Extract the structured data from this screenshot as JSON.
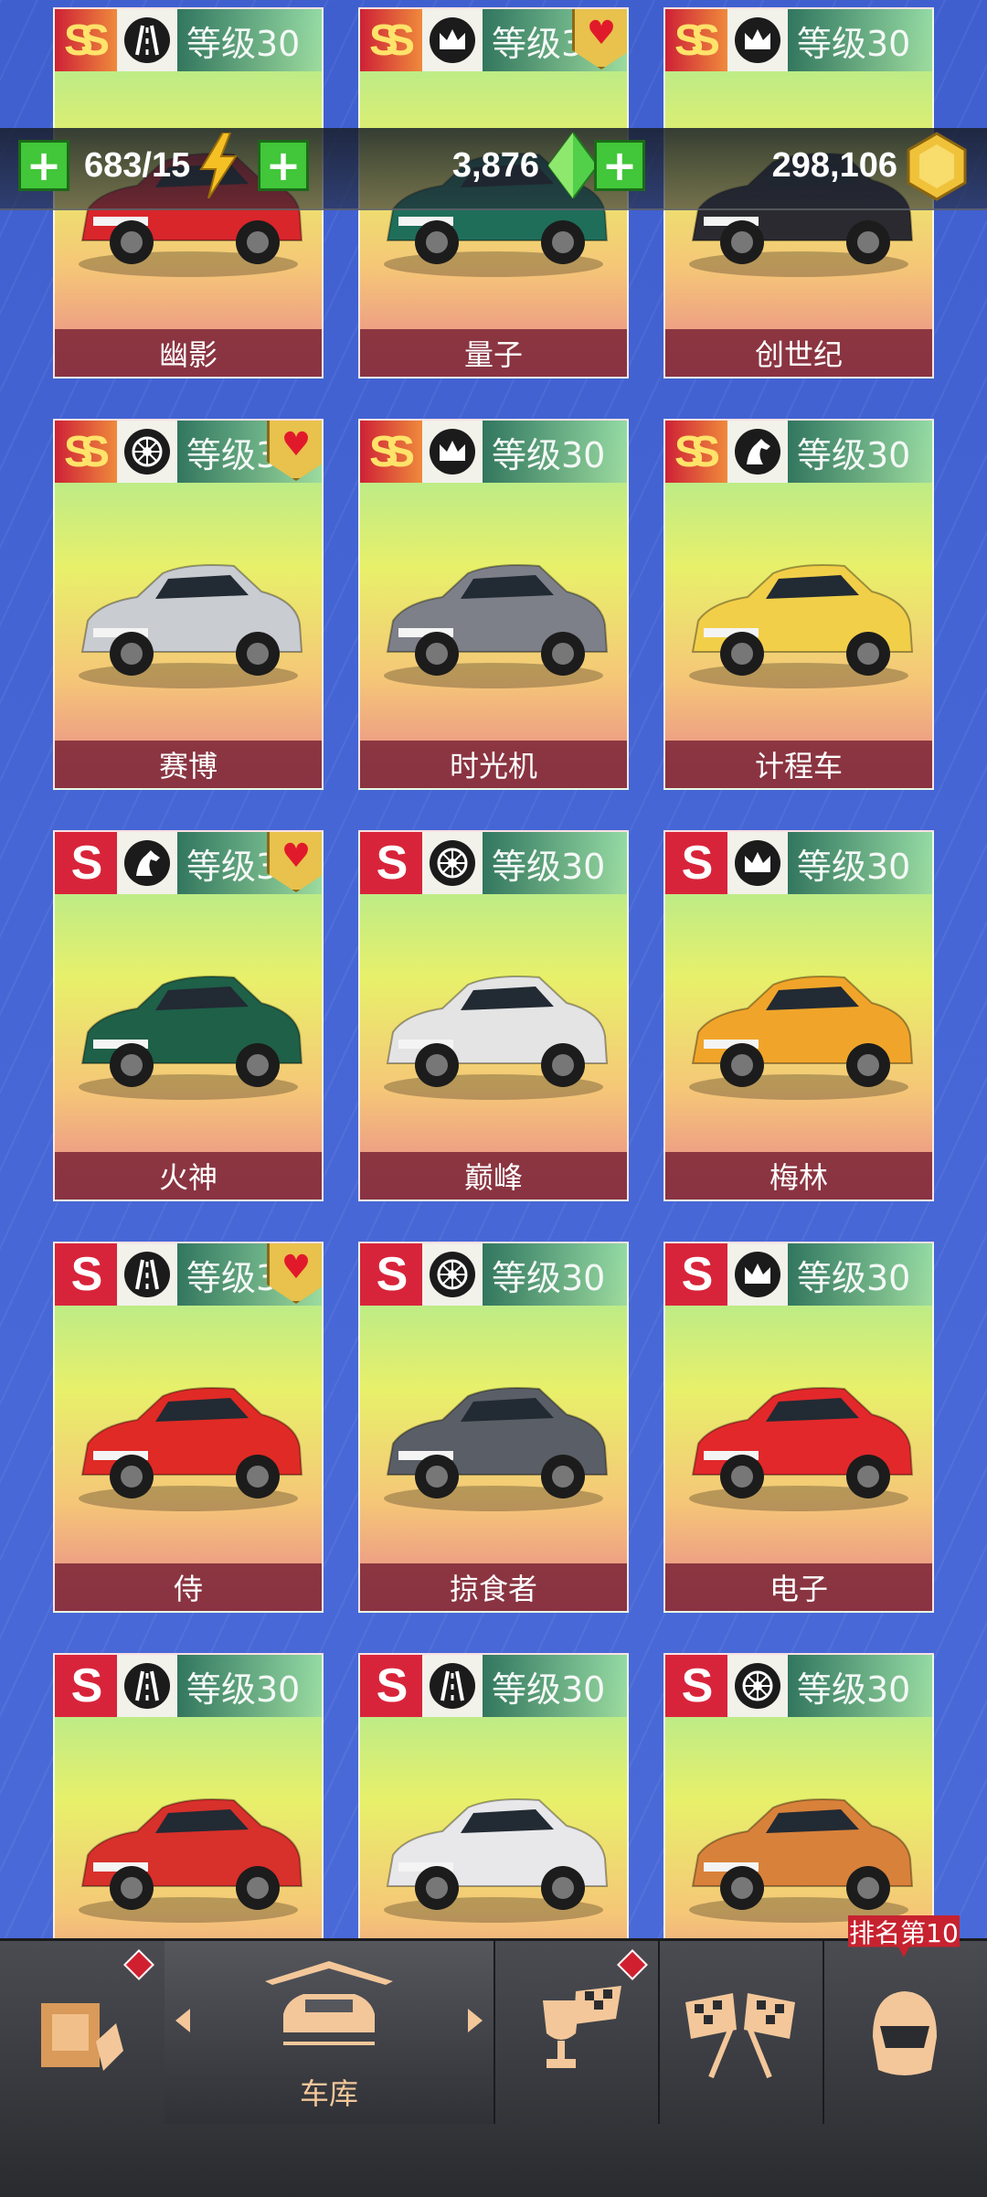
{
  "currency": {
    "energy": "683/15",
    "gems": "3,876",
    "coins": "298,106"
  },
  "cars": [
    {
      "rank": "SS",
      "tag": "road-icon",
      "level": "等级30",
      "fav": false,
      "name": "幽影",
      "color": "#d8262b"
    },
    {
      "rank": "SS",
      "tag": "crown-icon",
      "level": "等级3",
      "fav": true,
      "name": "量子",
      "color": "#1f6e5a"
    },
    {
      "rank": "SS",
      "tag": "crown-icon",
      "level": "等级30",
      "fav": false,
      "name": "创世纪",
      "color": "#2a2a30"
    },
    {
      "rank": "SS",
      "tag": "wheel-icon",
      "level": "等级3",
      "fav": true,
      "name": "赛博",
      "color": "#c9ccd0"
    },
    {
      "rank": "SS",
      "tag": "crown-icon",
      "level": "等级30",
      "fav": false,
      "name": "时光机",
      "color": "#7d8088"
    },
    {
      "rank": "SS",
      "tag": "horse-icon",
      "level": "等级30",
      "fav": false,
      "name": "计程车",
      "color": "#f2cf49"
    },
    {
      "rank": "S",
      "tag": "horse-icon",
      "level": "等级3",
      "fav": true,
      "name": "火神",
      "color": "#1e6048"
    },
    {
      "rank": "S",
      "tag": "wheel-icon",
      "level": "等级30",
      "fav": false,
      "name": "巅峰",
      "color": "#e4e4e4"
    },
    {
      "rank": "S",
      "tag": "crown-icon",
      "level": "等级30",
      "fav": false,
      "name": "梅林",
      "color": "#f0a52a"
    },
    {
      "rank": "S",
      "tag": "road-icon",
      "level": "等级3",
      "fav": true,
      "name": "侍",
      "color": "#e02a25"
    },
    {
      "rank": "S",
      "tag": "wheel-icon",
      "level": "等级30",
      "fav": false,
      "name": "掠食者",
      "color": "#5a5e66"
    },
    {
      "rank": "S",
      "tag": "crown-icon",
      "level": "等级30",
      "fav": false,
      "name": "电子",
      "color": "#e2282b"
    },
    {
      "rank": "S",
      "tag": "road-icon",
      "level": "等级30",
      "fav": false,
      "name": "",
      "color": "#d8302b"
    },
    {
      "rank": "S",
      "tag": "road-icon",
      "level": "等级30",
      "fav": false,
      "name": "",
      "color": "#e8e8ea"
    },
    {
      "rank": "S",
      "tag": "wheel-icon",
      "level": "等级30",
      "fav": false,
      "name": "",
      "color": "#d8813a"
    }
  ],
  "nav": {
    "garage_label": "车库",
    "rank_badge": "排名第10"
  },
  "colors": {
    "accent": "#f3c79a",
    "badge_red": "#c7222f",
    "plus_green": "#41c739"
  }
}
